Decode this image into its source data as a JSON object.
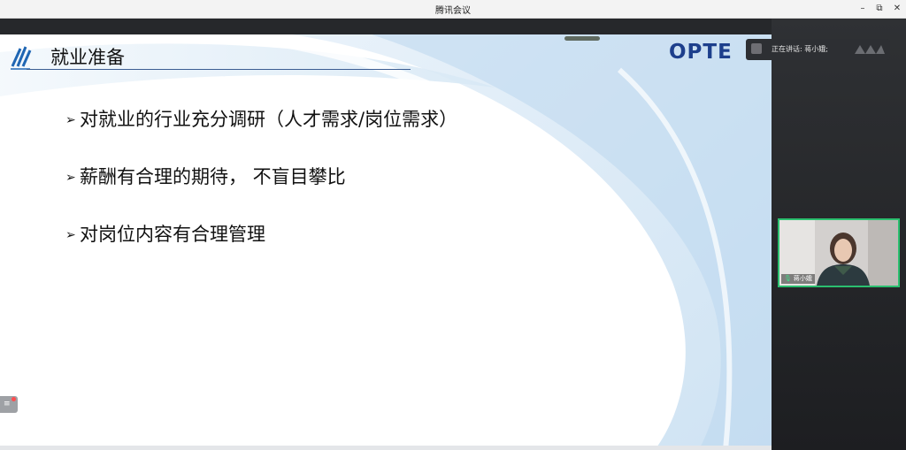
{
  "window": {
    "title": "腾讯会议",
    "minimize": "–",
    "restore": "⧉",
    "close": "✕"
  },
  "slide": {
    "title": "就业准备",
    "logo_text": "OPTE",
    "bullet_glyph": "➢",
    "bullets": [
      "对就业的行业充分调研（人才需求/岗位需求）",
      "薪酬有合理的期待， 不盲目攀比",
      "对岗位内容有合理管理"
    ]
  },
  "speaker_indicator": {
    "label": "正在讲话: 蒋小娥;"
  },
  "video": {
    "participant_name": "蒋小娥"
  },
  "colors": {
    "accent_blue": "#1d3f8c",
    "speaking_green": "#2bbf6f",
    "panel_dark": "#26282b"
  }
}
